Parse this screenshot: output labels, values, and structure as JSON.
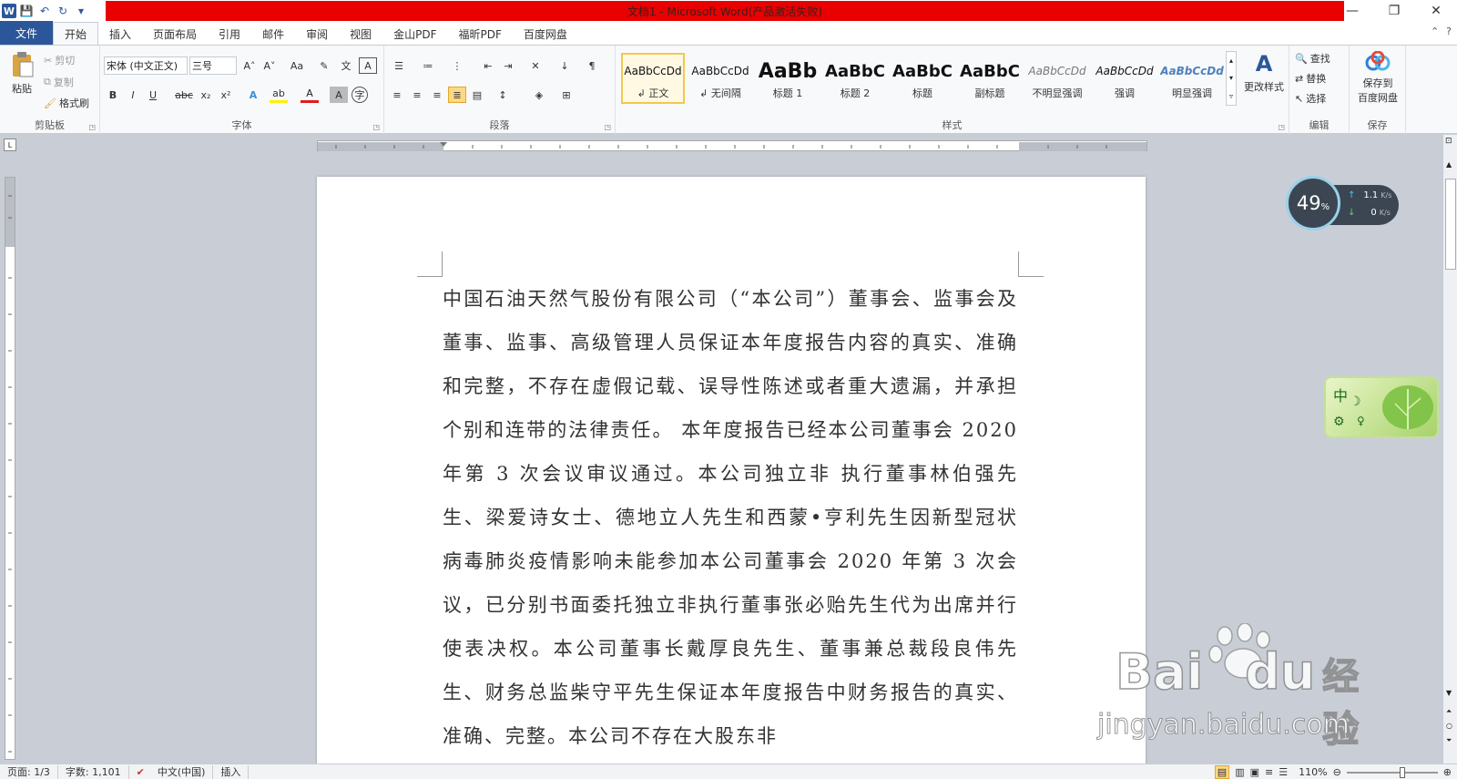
{
  "window": {
    "title": "文档1 - Microsoft Word(产品激活失败)",
    "controls": {
      "minimize": "—",
      "restore": "❐",
      "close": "✕"
    }
  },
  "qat": {
    "logo": "W",
    "save": "💾",
    "undo": "↶",
    "redo": "↻",
    "more": "▾"
  },
  "tabs": [
    "文件",
    "开始",
    "插入",
    "页面布局",
    "引用",
    "邮件",
    "审阅",
    "视图",
    "金山PDF",
    "福昕PDF",
    "百度网盘"
  ],
  "active_tab": "开始",
  "ribbon": {
    "clipboard": {
      "label": "剪贴板",
      "paste": "粘贴",
      "cut": "剪切",
      "copy": "复制",
      "format_painter": "格式刷"
    },
    "font": {
      "label": "字体",
      "font_name": "宋体 (中文正文)",
      "font_size": "三号",
      "bold": "B",
      "italic": "I",
      "underline": "U",
      "strike": "abc",
      "sub": "x₂",
      "sup": "x²",
      "grow": "A˄",
      "shrink": "A˅",
      "case": "Aa",
      "clear": "✎",
      "pinyin": "文",
      "border_char": "A",
      "highlight": "ab",
      "color": "A",
      "shade": "A",
      "circle": "字"
    },
    "paragraph": {
      "label": "段落"
    },
    "styles": {
      "label": "样式",
      "items": [
        {
          "sample": "AaBbCcDd",
          "name": "↲ 正文"
        },
        {
          "sample": "AaBbCcDd",
          "name": "↲ 无间隔"
        },
        {
          "sample": "AaBb",
          "name": "标题 1"
        },
        {
          "sample": "AaBbC",
          "name": "标题 2"
        },
        {
          "sample": "AaBbC",
          "name": "标题"
        },
        {
          "sample": "AaBbC",
          "name": "副标题"
        },
        {
          "sample": "AaBbCcDd",
          "name": "不明显强调"
        },
        {
          "sample": "AaBbCcDd",
          "name": "强调"
        },
        {
          "sample": "AaBbCcDd",
          "name": "明显强调"
        }
      ],
      "change_styles": "更改样式"
    },
    "editing": {
      "label": "编辑",
      "find": "查找",
      "replace": "替换",
      "select": "选择"
    },
    "save": {
      "label": "保存",
      "button": "保存到\n百度网盘"
    }
  },
  "document": {
    "paragraph": "中国石油天然气股份有限公司（“本公司”）董事会、监事会及董事、监事、高级管理人员保证本年度报告内容的真实、准确和完整，不存在虚假记载、误导性陈述或者重大遗漏，并承担个别和连带的法律责任。 本年度报告已经本公司董事会 2020 年第 3 次会议审议通过。本公司独立非 执行董事林伯强先生、梁爱诗女士、德地立人先生和西蒙•亨利先生因新型冠状病毒肺炎疫情影响未能参加本公司董事会 2020 年第 3 次会议，已分别书面委托独立非执行董事张必贻先生代为出席并行使表决权。本公司董事长戴厚良先生、董事兼总裁段良伟先生、财务总监柴守平先生保证本年度报告中财务报告的真实、准确、完整。本公司不存在大股东非"
  },
  "net_widget": {
    "percent": "49",
    "percent_unit": "%",
    "up": "1.1",
    "up_unit": "K/s",
    "down": "0",
    "down_unit": "K/s"
  },
  "ime": {
    "lang": "中",
    "moon": "☽",
    "gear": "⚙",
    "key": "♀"
  },
  "watermark": {
    "brand": "Bai",
    "brand2": "du",
    "cn": "经验",
    "url": "jingyan.baidu.com"
  },
  "status": {
    "page": "页面: 1/3",
    "words": "字数: 1,101",
    "language": "中文(中国)",
    "mode": "插入",
    "zoom": "110%"
  }
}
